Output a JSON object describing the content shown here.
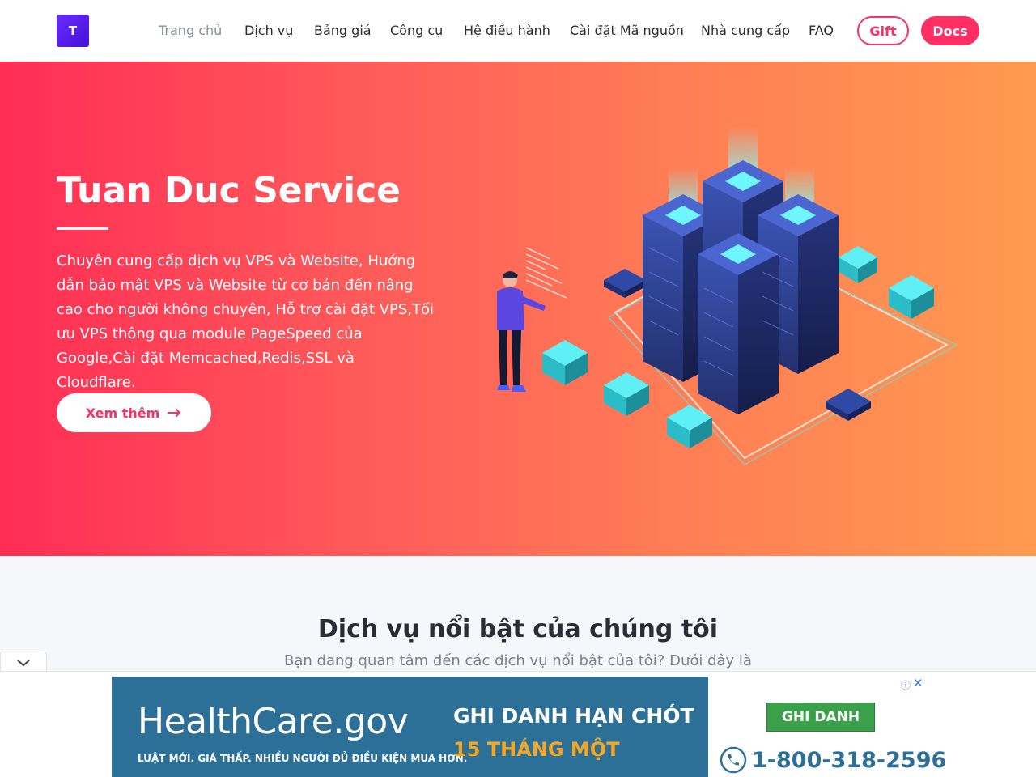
{
  "logo": {
    "letter": "T"
  },
  "nav": {
    "items": [
      {
        "label": "Trang chủ",
        "active": true
      },
      {
        "label": "Dịch vụ"
      },
      {
        "label": "Bảng giá"
      },
      {
        "label": "Công cụ"
      },
      {
        "label": "Hệ điều hành"
      },
      {
        "label": "Cài đặt Mã nguồn"
      },
      {
        "label": "Nhà cung cấp"
      },
      {
        "label": "FAQ"
      }
    ],
    "gift_label": "Gift",
    "docs_label": "Docs"
  },
  "hero": {
    "title": "Tuan Duc Service",
    "description": "Chuyên cung cấp dịch vụ VPS và Website, Hướng dẫn bảo mật VPS và Website từ cơ bản đến nâng cao cho người không chuyên, Hỗ trợ cài đặt VPS,Tối ưu VPS thông qua module PageSpeed của Google,Cài đặt Memcached,Redis,SSL và Cloudflare.",
    "button_label": "Xem thêm",
    "button_icon": "arrow-right-icon"
  },
  "section": {
    "title": "Dịch vụ nổi bật của chúng tôi",
    "subtitle": "Bạn đang quan tâm đến các dịch vụ nổi bật của tôi? Dưới đây là"
  },
  "ad": {
    "brand": "HealthCare.gov",
    "tagline": "LUẬT MỚI. GIÁ THẤP. NHIỀU NGƯỜI ĐỦ ĐIỀU KIỆN MUA HƠN.",
    "headline": "GHI DANH HẠN CHÓT",
    "date": "15 THÁNG MỘT",
    "enroll_label": "GHI DANH",
    "phone": "1-800-318-2596",
    "info_icon": "info-icon",
    "close_icon": "close-icon"
  },
  "colors": {
    "accent": "#ff2e63",
    "hero_start": "#ff2d55",
    "hero_end": "#ff9a50",
    "ad_blue": "#2c6f97"
  }
}
